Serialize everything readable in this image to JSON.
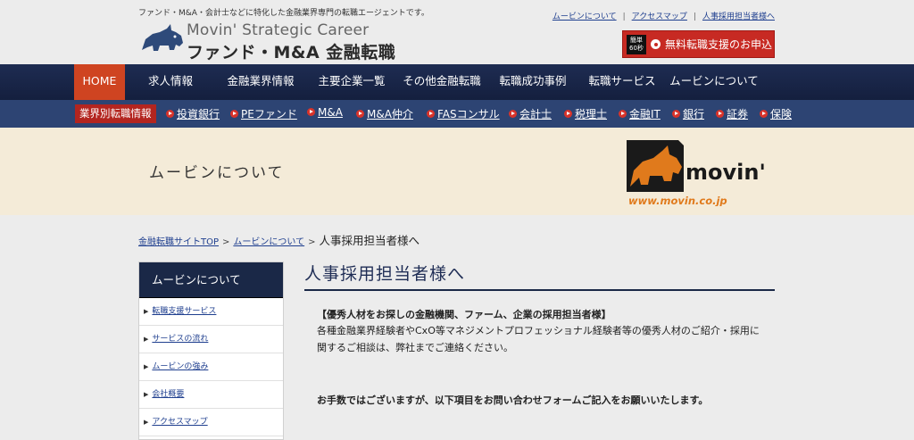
{
  "header": {
    "tagline": "ファンド・M&A・会計士などに特化した金融業界専門の転職エージェントです。",
    "logo_en": "Movin' Strategic Career",
    "logo_jp": "ファンド・M&A 金融転職",
    "top_links": [
      "ムービンについて",
      "アクセスマップ",
      "人事採用担当者様へ"
    ],
    "apply_badge": "簡単60秒",
    "apply_label": "無料転職支援のお申込"
  },
  "main_nav": [
    "HOME",
    "求人情報",
    "金融業界情報",
    "主要企業一覧",
    "その他金融転職",
    "転職成功事例",
    "転職サービス",
    "ムービンについて"
  ],
  "sub_nav": {
    "label": "業界別転職情報",
    "items": [
      "投資銀行",
      "PEファンド",
      "M&A",
      "M&A仲介",
      "FASコンサル",
      "会計士",
      "税理士",
      "金融IT",
      "銀行",
      "証券",
      "保険"
    ]
  },
  "banner": {
    "title": "ムービンについて",
    "logo_text": "movin'",
    "logo_url": "www.movin.co.jp"
  },
  "breadcrumb": {
    "items": [
      "金融転職サイトTOP",
      "ムービンについて"
    ],
    "current": "人事採用担当者様へ"
  },
  "sidebar": {
    "heading": "ムービンについて",
    "items": [
      "転職支援サービス",
      "サービスの流れ",
      "ムービンの強み",
      "会社概要",
      "アクセスマップ"
    ]
  },
  "content": {
    "title": "人事採用担当者様へ",
    "heading": "【優秀人材をお探しの金融機関、ファーム、企業の採用担当者様】",
    "body": "各種金融業界経験者やCxO等マネジメントプロフェッショナル経験者等の優秀人材のご紹介・採用に関するご相談は、弊社までご連絡ください。",
    "note": "お手数ではございますが、以下項目をお問い合わせフォームご記入をお願いいたします。"
  },
  "colors": {
    "nav_bg": "#1e2c52",
    "home_active": "#cf4421",
    "subnav_bg": "#2d4473",
    "accent_red": "#c72a23",
    "link": "#1f3f8f"
  }
}
